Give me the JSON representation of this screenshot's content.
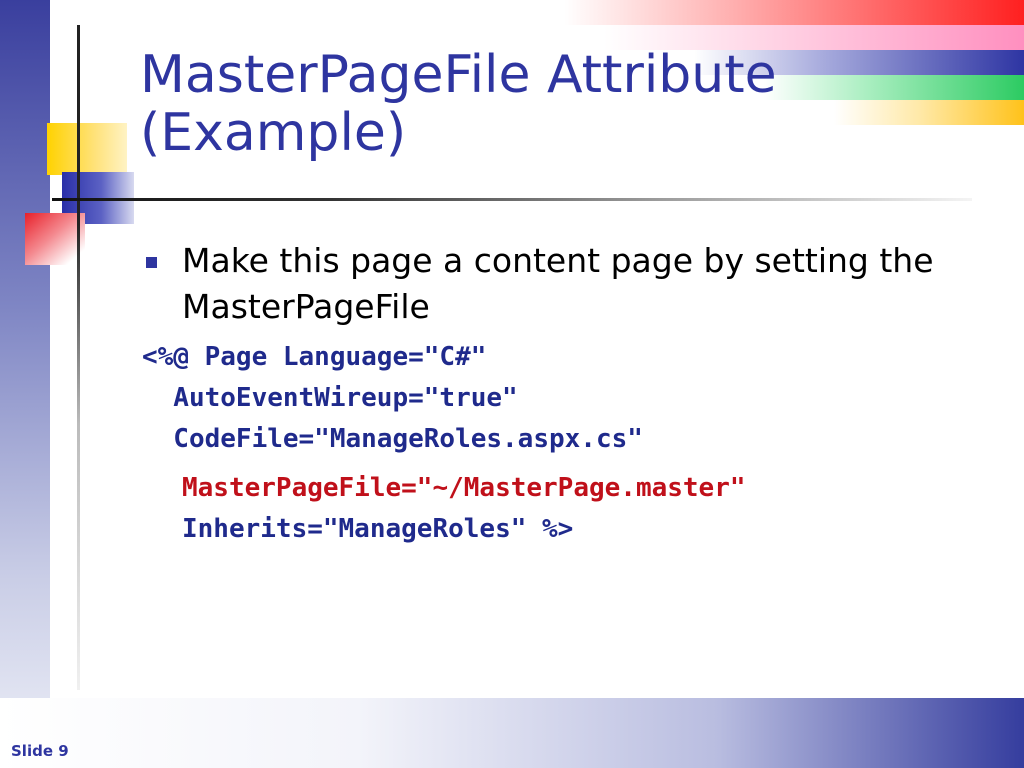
{
  "slide": {
    "title_line1": "MasterPageFile Attribute",
    "title_line2": "(Example)",
    "bullet": {
      "icon": "square-bullet-icon",
      "line1": "Make this page a content page by setting the",
      "line2": "MasterPageFile"
    },
    "code_block_1": [
      "<%@ Page Language=\"C#\"",
      "  AutoEventWireup=\"true\"",
      "  CodeFile=\"ManageRoles.aspx.cs\""
    ],
    "code_block_2": {
      "highlight_line": "MasterPageFile=\"~/MasterPage.master\"",
      "last_line": "Inherits=\"ManageRoles\" %>"
    },
    "footer": "Slide 9"
  },
  "colors": {
    "title": "#2e35a0",
    "code": "#1f2a8c",
    "code_highlight": "#c0101a",
    "accent_red": "#ff2020",
    "accent_pink": "#ff8fbf",
    "accent_blue": "#2e35a3",
    "accent_green": "#2ccb62",
    "accent_yellow": "#ffc21a"
  }
}
